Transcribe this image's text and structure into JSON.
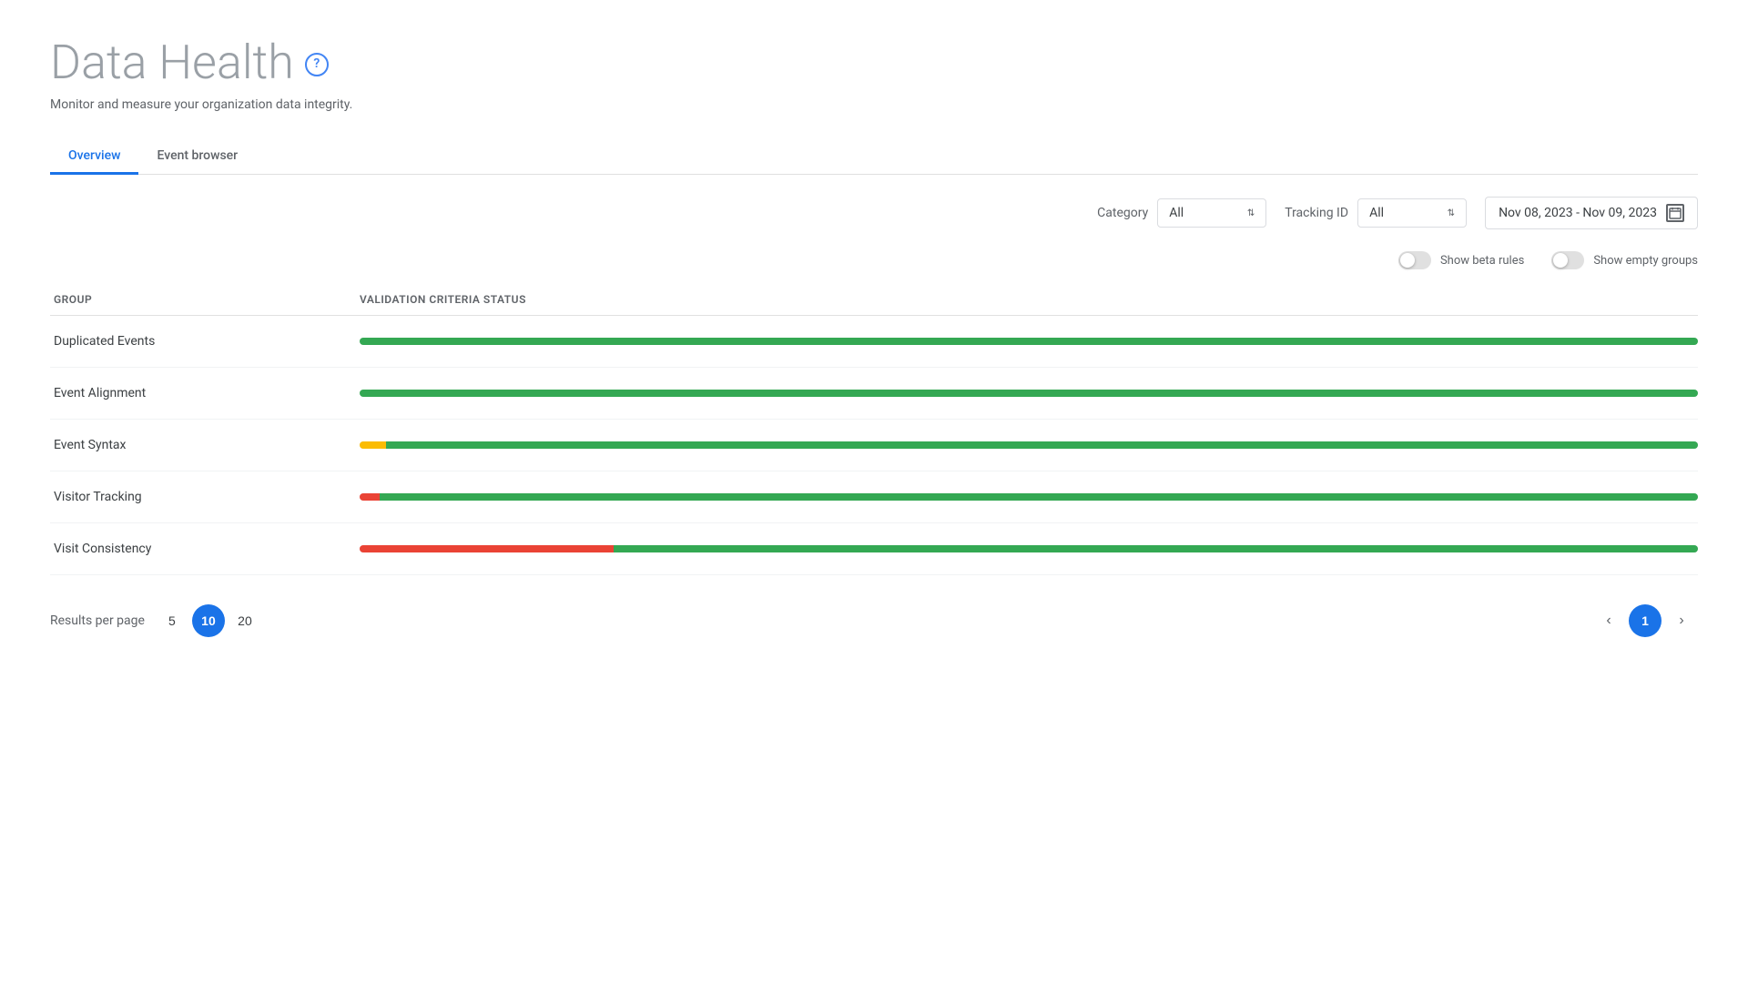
{
  "page": {
    "title": "Data Health",
    "subtitle": "Monitor and measure your organization data integrity.",
    "help_icon": "?"
  },
  "tabs": [
    {
      "id": "overview",
      "label": "Overview",
      "active": true
    },
    {
      "id": "event-browser",
      "label": "Event browser",
      "active": false
    }
  ],
  "filters": {
    "category_label": "Category",
    "category_value": "All",
    "tracking_id_label": "Tracking ID",
    "tracking_id_value": "All",
    "date_range": "Nov 08, 2023 - Nov 09, 2023"
  },
  "options": {
    "show_beta_rules_label": "Show beta rules",
    "show_empty_groups_label": "Show empty groups"
  },
  "table": {
    "col_group": "Group",
    "col_status": "Validation criteria status",
    "rows": [
      {
        "name": "Duplicated Events",
        "red_pct": 0,
        "yellow_pct": 0,
        "green_pct": 100
      },
      {
        "name": "Event Alignment",
        "red_pct": 0,
        "yellow_pct": 0,
        "green_pct": 100
      },
      {
        "name": "Event Syntax",
        "red_pct": 0,
        "yellow_pct": 2,
        "green_pct": 98
      },
      {
        "name": "Visitor Tracking",
        "red_pct": 1.5,
        "yellow_pct": 0,
        "green_pct": 98.5
      },
      {
        "name": "Visit Consistency",
        "red_pct": 19,
        "yellow_pct": 0,
        "green_pct": 81
      }
    ]
  },
  "pagination": {
    "results_per_page_label": "Results per page",
    "options": [
      "5",
      "10",
      "20"
    ],
    "active_option": "10",
    "current_page": "1",
    "prev_icon": "‹",
    "next_icon": "›"
  }
}
